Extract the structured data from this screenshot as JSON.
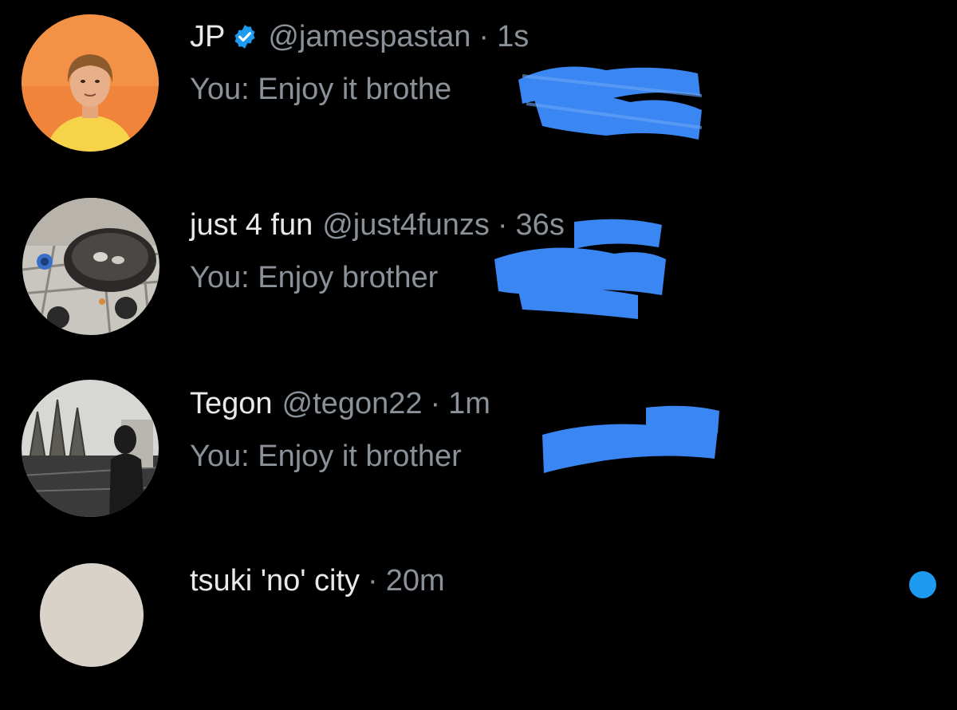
{
  "conversations": [
    {
      "display_name": "JP",
      "verified": true,
      "handle": "@jamespastan",
      "separator": "·",
      "time": "1s",
      "preview": "You: Enjoy it brothe"
    },
    {
      "display_name": "just 4 fun",
      "verified": false,
      "handle": "@just4funzs",
      "separator": "·",
      "time": "36s",
      "preview": "You: Enjoy brother"
    },
    {
      "display_name": "Tegon",
      "verified": false,
      "handle": "@tegon22",
      "separator": "·",
      "time": "1m",
      "preview": "You: Enjoy it brother"
    },
    {
      "display_name": "tsuki 'no' city",
      "verified": false,
      "handle": "",
      "separator": "·",
      "time": "20m",
      "preview": ""
    }
  ],
  "icons": {
    "verified": "verified-badge-icon",
    "unread": "unread-dot-icon"
  },
  "colors": {
    "background": "#000000",
    "primary_text": "#e7e9ea",
    "secondary_text": "#8b9198",
    "accent_blue": "#1d9bf0",
    "redaction_blue": "#3a86f2"
  }
}
